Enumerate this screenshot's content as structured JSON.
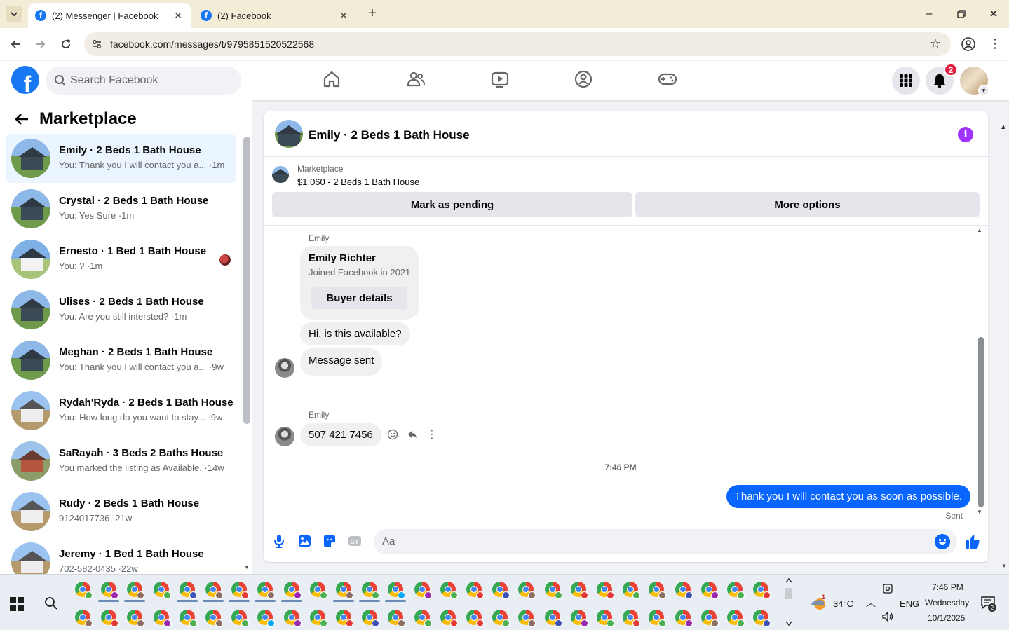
{
  "browser": {
    "tabs": [
      {
        "title": "(2) Messenger | Facebook",
        "active": true
      },
      {
        "title": "(2) Facebook",
        "active": false
      }
    ],
    "url": "facebook.com/messages/t/9795851520522568"
  },
  "fbnav": {
    "search_placeholder": "Search Facebook",
    "notification_count": "2"
  },
  "sidebar": {
    "title": "Marketplace",
    "conversations": [
      {
        "name": "Emily · 2 Beds 1 Bath House",
        "preview": "You: Thank you I will contact you a... ·1m",
        "selected": true
      },
      {
        "name": "Crystal · 2 Beds 1 Bath House",
        "preview": "You: Yes Sure ·1m"
      },
      {
        "name": "Ernesto · 1 Bed 1 Bath House",
        "preview": "You: ? ·1m"
      },
      {
        "name": "Ulises · 2 Beds 1 Bath House",
        "preview": "You: Are you still intersted? ·1m"
      },
      {
        "name": "Meghan · 2 Beds 1 Bath House",
        "preview": "You: Thank you I will contact you a... ·9w"
      },
      {
        "name": "Rydah'Ryda · 2 Beds 1 Bath House",
        "preview": "You: How long do you want to stay... ·9w"
      },
      {
        "name": "SaRayah · 3 Beds 2 Baths House",
        "preview": "You marked the listing as Available. ·14w"
      },
      {
        "name": "Rudy · 2 Beds 1 Bath House",
        "preview": "9124017736 ·21w"
      },
      {
        "name": "Jeremy · 1 Bed 1 Bath House",
        "preview": "702-582-0435 ·22w"
      }
    ]
  },
  "chat": {
    "title": "Emily · 2 Beds 1 Bath House",
    "marketplace_label": "Marketplace",
    "listing": "$1,060 - 2 Beds 1 Bath House",
    "mark_pending": "Mark as pending",
    "more_options": "More options",
    "sender_1": "Emily",
    "profile_name": "Emily Richter",
    "profile_joined": "Joined Facebook in 2021",
    "buyer_details": "Buyer details",
    "msg_available": "Hi, is this available?",
    "msg_sent_notice": "Message sent",
    "sender_2": "Emily",
    "msg_phone": "507 421 7456",
    "timestamp": "7:46 PM",
    "msg_out": "Thank you I will contact  you as soon as possible.",
    "sent_status": "Sent",
    "composer_placeholder": "Aa"
  },
  "taskbar": {
    "temperature": "34°C",
    "language": "ENG",
    "time": "7:46 PM",
    "day": "Wednesday",
    "date": "10/1/2025",
    "weather_badge": "1",
    "notification_badge": "2"
  },
  "colors": {
    "facebook_blue": "#1877f2",
    "messenger_blue": "#0866ff",
    "info_purple": "#a033ff",
    "badge_red": "#e41e3f"
  }
}
